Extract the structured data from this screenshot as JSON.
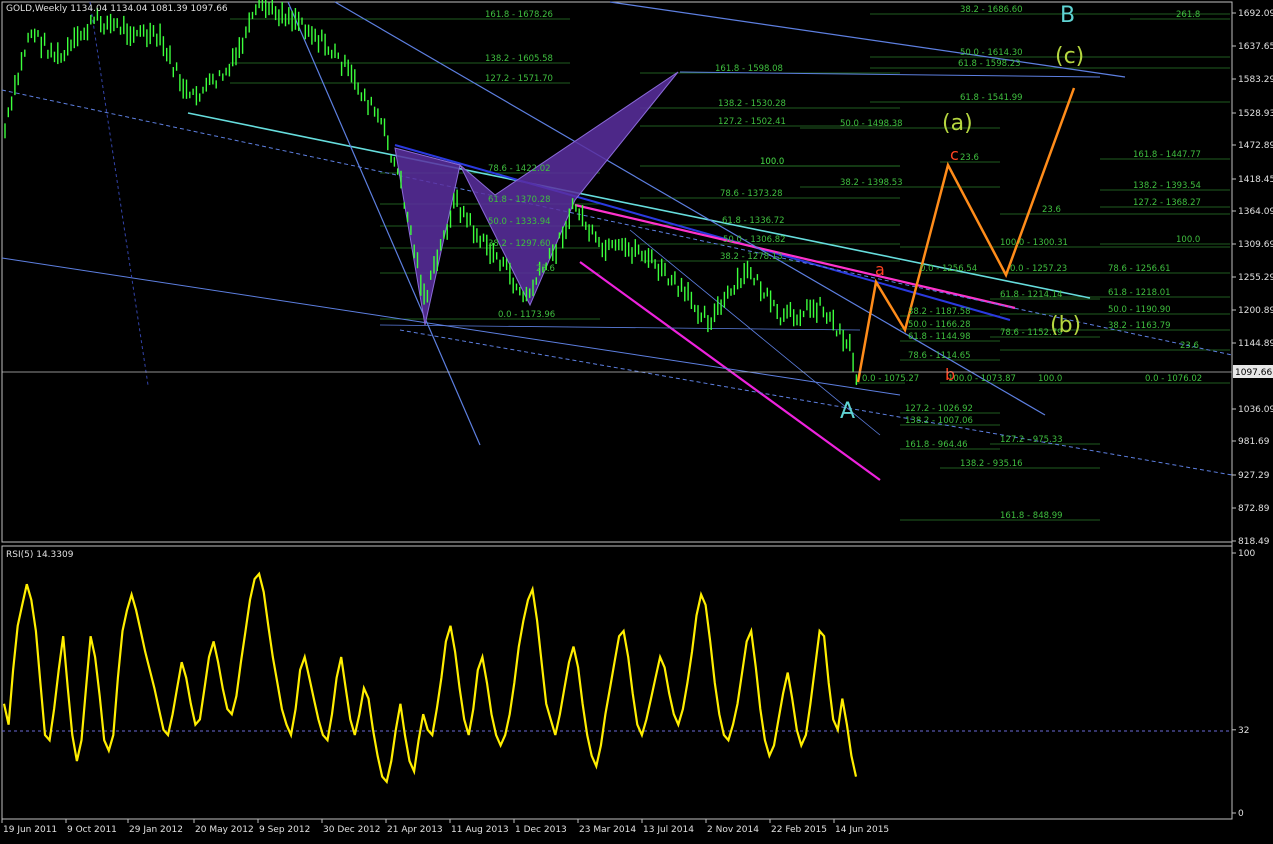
{
  "chart_data": {
    "type": "line",
    "symbol_header": "GOLD,Weekly  1134.04 1134.04 1081.39 1097.66",
    "price_axis": {
      "ticks": [
        1692.09,
        1637.65,
        1583.29,
        1528.93,
        1472.89,
        1418.45,
        1364.09,
        1309.69,
        1255.29,
        1200.89,
        1144.89,
        1097.66,
        1036.09,
        981.69,
        927.29,
        872.89,
        818.49
      ],
      "current_price": 1097.66
    },
    "x_axis": {
      "ticks": [
        "19 Jun 2011",
        "9 Oct 2011",
        "29 Jan 2012",
        "20 May 2012",
        "9 Sep 2012",
        "30 Dec 2012",
        "21 Apr 2013",
        "11 Aug 2013",
        "1 Dec 2013",
        "23 Mar 2014",
        "13 Jul 2014",
        "2 Nov 2014",
        "22 Feb 2015",
        "14 Jun 2015"
      ]
    },
    "wave_labels": [
      "A",
      "B",
      "(a)",
      "(b)",
      "(c)",
      "a",
      "b",
      "c"
    ],
    "fib_levels": [
      "161.8 - 1678.26",
      "138.2 - 1605.58",
      "127.2 - 1571.70",
      "161.8 - 1598.08",
      "138.2 - 1530.28",
      "127.2 - 1502.41",
      "100.0",
      "78.6 - 1422.02",
      "61.8 - 1370.28",
      "50.0 - 1333.94",
      "38.2 - 1297.60",
      "23.6",
      "0.0 - 1173.96",
      "38.2 - 1686.60",
      "50.0 - 1614.30",
      "61.8 - 1598.23",
      "61.8 - 1541.99",
      "50.0 - 1498.38",
      "38.2 - 1398.53",
      "100.0",
      "78.6 - 1373.28",
      "61.8 - 1336.72",
      "50.0 - 1306.82",
      "38.2 - 1278.13",
      "261.8",
      "161.8 - 1447.77",
      "138.2 - 1393.54",
      "127.2 - 1368.27",
      "100.0",
      "78.6 - 1256.61",
      "61.8 - 1218.01",
      "50.0 - 1190.90",
      "38.2 - 1163.79",
      "0.0 - 1076.02",
      "23.6",
      "23.6",
      "100.0 - 1300.31",
      "0.0 - 1256.54",
      "0.0 - 1257.23",
      "23.6",
      "61.8 - 1214.14",
      "38.2 - 1187.58",
      "50.0 - 1166.28",
      "61.8 - 1144.98",
      "78.6 - 1152.79",
      "78.6 - 1114.65",
      "100.0 - 1073.87",
      "0.0 - 1075.27",
      "100.0",
      "127.2 - 1026.92",
      "138.2 - 1007.06",
      "161.8 - 964.46",
      "127.2 - 975.33",
      "138.2 - 935.16",
      "161.8 - 848.99"
    ],
    "rsi": {
      "header": "RSI(5) 14.3309",
      "ticks": [
        "100",
        "32",
        "0"
      ],
      "level": 32,
      "values": [
        42,
        34,
        55,
        72,
        80,
        88,
        82,
        70,
        50,
        30,
        28,
        40,
        55,
        68,
        48,
        30,
        20,
        28,
        48,
        68,
        60,
        45,
        28,
        24,
        30,
        52,
        70,
        78,
        84,
        78,
        70,
        62,
        55,
        48,
        40,
        32,
        30,
        38,
        48,
        58,
        52,
        42,
        34,
        36,
        48,
        60,
        66,
        58,
        48,
        40,
        38,
        45,
        58,
        70,
        82,
        90,
        92,
        85,
        72,
        60,
        50,
        40,
        34,
        30,
        40,
        55,
        60,
        52,
        44,
        36,
        30,
        28,
        38,
        52,
        60,
        48,
        36,
        30,
        38,
        48,
        44,
        32,
        22,
        14,
        12,
        20,
        32,
        42,
        30,
        20,
        16,
        28,
        38,
        32,
        30,
        40,
        52,
        66,
        72,
        62,
        48,
        36,
        30,
        40,
        55,
        60,
        50,
        38,
        30,
        26,
        30,
        38,
        50,
        64,
        74,
        82,
        86,
        74,
        58,
        42,
        36,
        30,
        38,
        48,
        58,
        64,
        56,
        42,
        30,
        22,
        18,
        26,
        38,
        48,
        58,
        68,
        70,
        60,
        46,
        34,
        30,
        36,
        44,
        52,
        60,
        56,
        46,
        38,
        34,
        40,
        50,
        62,
        76,
        84,
        80,
        66,
        50,
        38,
        30,
        28,
        34,
        42,
        54,
        66,
        70,
        56,
        40,
        28,
        22,
        26,
        36,
        46,
        54,
        44,
        32,
        26,
        30,
        42,
        56,
        70,
        68,
        50,
        36,
        32,
        44,
        34,
        22,
        14
      ]
    }
  }
}
